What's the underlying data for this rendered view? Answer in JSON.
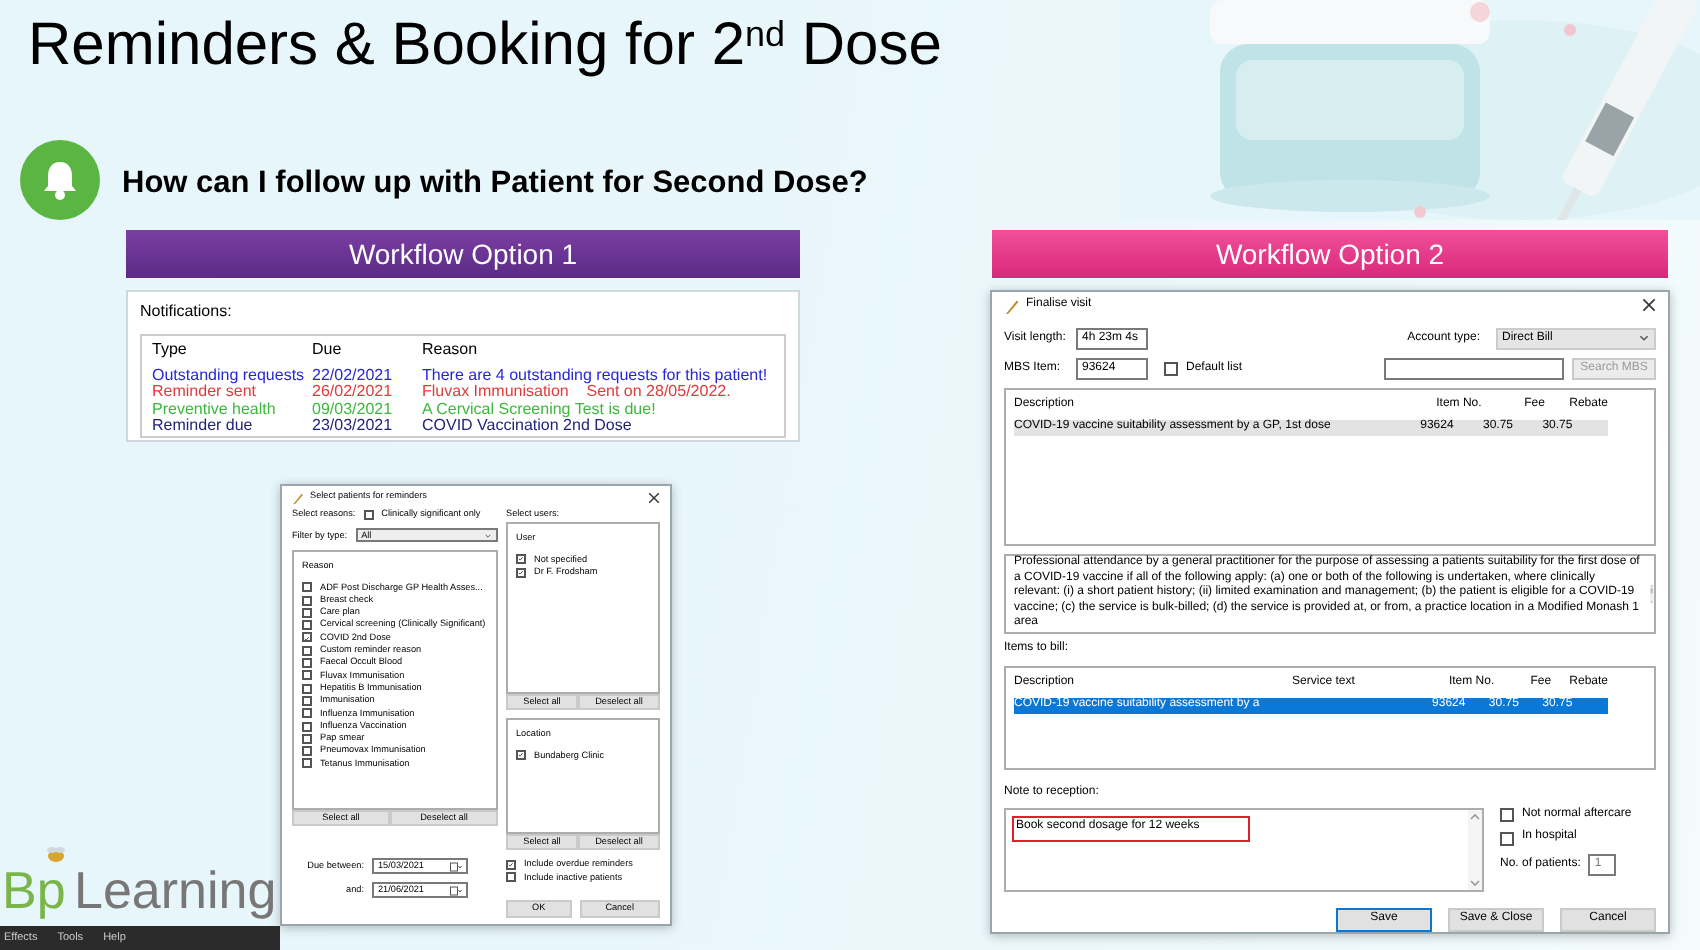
{
  "slide": {
    "title": "Reminders & Booking for 2$^{nd}$ Dose",
    "question": "How can I follow up with Patient for Second Dose?"
  },
  "option_1": {
    "banner": "Workflow Option 1",
    "notifications": {
      "label": "Notifications:",
      "columns": [
        "Type",
        "Due",
        "Reason"
      ],
      "rows": [
        {
          "type": "Outstanding requests",
          "due": "22/02/2021",
          "reason": "There are 4 outstanding requests for this patient!",
          "color": "#2626d9"
        },
        {
          "type": "Reminder sent",
          "due": "26/02/2021",
          "reason": "Fluvax Immunisation    Sent on 28/05/2022.",
          "color": "#e03a3a"
        },
        {
          "type": "Preventive health",
          "due": "09/03/2021",
          "reason": "A Cervical Screening Test is due!",
          "color": "#3cb83c"
        },
        {
          "type": "Reminder due",
          "due": "23/03/2021",
          "reason": "COVID Vaccination 2nd Dose",
          "color": "#23237a"
        }
      ]
    },
    "reminders_dialog": {
      "title": "Select patients for reminders",
      "reasons_label": "Select reasons:",
      "clinically_significant": {
        "label": "Clinically significant only",
        "checked": false
      },
      "filter_label": "Filter by type:",
      "filter_value": "All",
      "reason_header": "Reason",
      "reasons": [
        {
          "label": "ADF Post Discharge GP Health Asses...",
          "checked": false
        },
        {
          "label": "Breast check",
          "checked": false
        },
        {
          "label": "Care plan",
          "checked": false
        },
        {
          "label": "Cervical screening (Clinically Significant)",
          "checked": false
        },
        {
          "label": "COVID 2nd Dose",
          "checked": true
        },
        {
          "label": "Custom reminder reason",
          "checked": false
        },
        {
          "label": "Faecal Occult Blood",
          "checked": false
        },
        {
          "label": "Fluvax Immunisation",
          "checked": false
        },
        {
          "label": "Hepatitis B Immunisation",
          "checked": false
        },
        {
          "label": "Immunisation",
          "checked": false
        },
        {
          "label": "Influenza Immunisation",
          "checked": false
        },
        {
          "label": "Influenza Vaccination",
          "checked": false
        },
        {
          "label": "Pap smear",
          "checked": false
        },
        {
          "label": "Pneumovax Immunisation",
          "checked": false
        },
        {
          "label": "Tetanus Immunisation",
          "checked": false
        }
      ],
      "reasons_buttons": [
        "Select all",
        "Deselect all"
      ],
      "users_label": "Select users:",
      "user_header": "User",
      "users": [
        {
          "label": "Not specified",
          "checked": true
        },
        {
          "label": "Dr F. Frodsham",
          "checked": true
        }
      ],
      "users_buttons": [
        "Select all",
        "Deselect all"
      ],
      "location_header": "Location",
      "locations": [
        {
          "label": "Bundaberg Clinic",
          "checked": true
        }
      ],
      "location_buttons": [
        "Select all",
        "Deselect all"
      ],
      "due_between_label": "Due between:",
      "due_from": "15/03/2021",
      "and_label": "and:",
      "due_to": "21/06/2021",
      "options": [
        {
          "label": "Include overdue reminders",
          "checked": true
        },
        {
          "label": "Include inactive patients",
          "checked": false
        }
      ],
      "buttons": [
        "OK",
        "Cancel"
      ]
    }
  },
  "option_2": {
    "banner": "Workflow Option 2",
    "finalise_visit": {
      "title": "Finalise visit",
      "visit_length_label": "Visit length:",
      "visit_length": "4h 23m 4s",
      "account_type_label": "Account type:",
      "account_type": "Direct Bill",
      "mbs_item_label": "MBS Item:",
      "mbs_item": "93624",
      "default_list": {
        "label": "Default list",
        "checked": false
      },
      "search_button": {
        "label": "Search MBS",
        "disabled": true
      },
      "mbs_table": {
        "focused": false,
        "columns": [
          "Description",
          "Item No.",
          "Fee",
          "Rebate"
        ],
        "rows": [
          {
            "description": "COVID-19 vaccine suitability assessment by a GP, 1st dose",
            "item_no": "93624",
            "fee": "30.75",
            "rebate": "30.75",
            "selected": true
          }
        ]
      },
      "item_description": "Professional attendance by a general practitioner for the purpose of assessing a patients suitability for the first dose of a COVID-19 vaccine if all of the following apply: (a) one or both of the following is undertaken, where clinically relevant: (i) a short patient history; (ii) limited examination and management; (b) the patient is eligible for a COVID-19 vaccine; (c) the service is bulk-billed; (d) the service is provided at, or from, a practice location in a Modified Monash 1 area",
      "items_label": "Items to bill:",
      "bill_table": {
        "focused": true,
        "columns": [
          "Description",
          "Service text",
          "Item No.",
          "Fee",
          "Rebate"
        ],
        "rows": [
          {
            "description": "COVID-19 vaccine suitability assessment by a",
            "item_no": "93624",
            "fee": "30.75",
            "rebate": "30.75",
            "selected": true
          }
        ]
      },
      "note_label": "Note to reception:",
      "note": "Book second dosage for 12 weeks",
      "note_highlighted": true,
      "flags": [
        {
          "label": "Not normal aftercare",
          "checked": false
        },
        {
          "label": "In hospital",
          "checked": false
        }
      ],
      "patients_label": "No. of patients:",
      "patients": "1",
      "buttons": [
        {
          "label": "Save",
          "default": true
        },
        {
          "label": "Save & Close",
          "default": false
        },
        {
          "label": "Cancel",
          "default": false
        }
      ]
    }
  },
  "logo": {
    "mark": "Bp",
    "word": "Learning"
  },
  "menu_bar": [
    "Effects",
    "Tools",
    "Help"
  ]
}
